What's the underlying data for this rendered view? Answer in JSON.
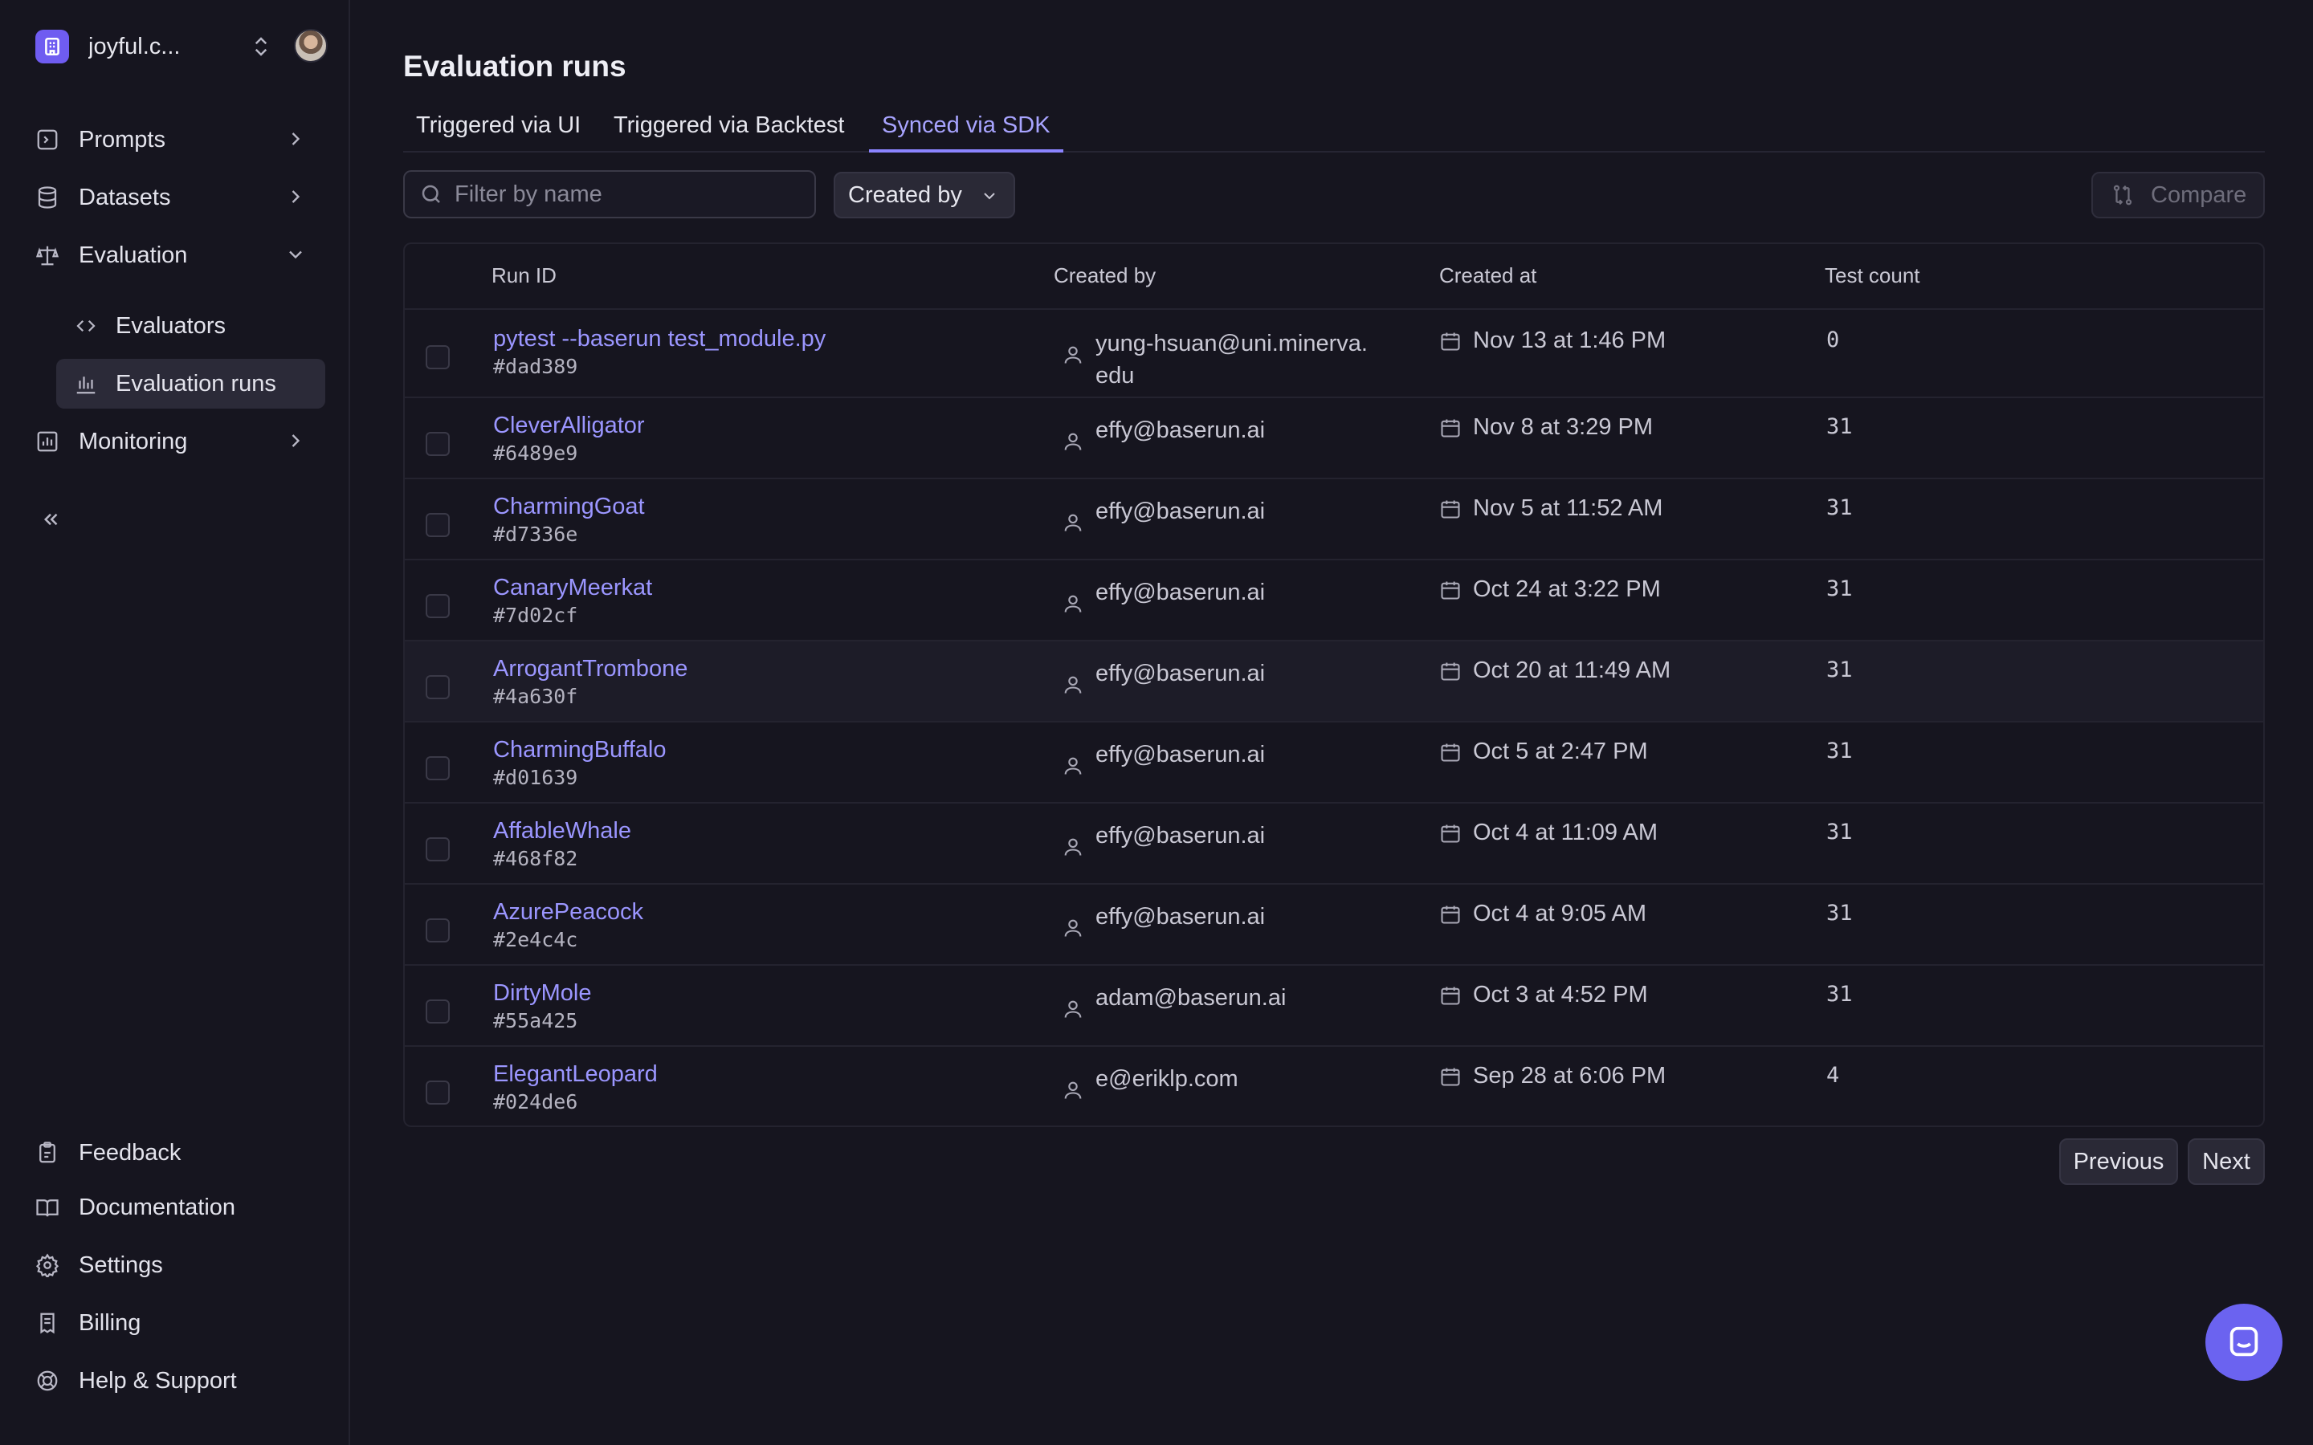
{
  "org": {
    "name": "joyful.c...",
    "logo_icon": "building-icon"
  },
  "sidebar": {
    "items": [
      {
        "label": "Prompts",
        "icon": "prompt-icon",
        "expanded": false
      },
      {
        "label": "Datasets",
        "icon": "database-icon",
        "expanded": false
      },
      {
        "label": "Evaluation",
        "icon": "scale-icon",
        "expanded": true
      },
      {
        "label": "Monitoring",
        "icon": "chart-icon",
        "expanded": false
      }
    ],
    "evaluation_children": [
      {
        "label": "Evaluators",
        "icon": "code-icon"
      },
      {
        "label": "Evaluation runs",
        "icon": "bar-chart-icon",
        "active": true
      }
    ],
    "footer": [
      {
        "label": "Feedback",
        "icon": "clipboard-icon"
      },
      {
        "label": "Documentation",
        "icon": "book-icon"
      },
      {
        "label": "Settings",
        "icon": "gear-icon"
      },
      {
        "label": "Billing",
        "icon": "receipt-icon"
      },
      {
        "label": "Help & Support",
        "icon": "lifebuoy-icon"
      }
    ]
  },
  "page": {
    "title": "Evaluation runs"
  },
  "tabs": [
    {
      "label": "Triggered via UI"
    },
    {
      "label": "Triggered via Backtest"
    },
    {
      "label": "Synced via SDK",
      "active": true
    }
  ],
  "filters": {
    "search_placeholder": "Filter by name",
    "search_value": "",
    "created_by_label": "Created by",
    "compare_label": "Compare"
  },
  "table": {
    "columns": [
      "Run ID",
      "Created by",
      "Created at",
      "Test count"
    ],
    "rows": [
      {
        "name": "pytest --baserun test_module.py",
        "hash": "#dad389",
        "creator": "yung-hsuan@uni.minerva.edu",
        "created_at": "Nov 13 at 1:46 PM",
        "count": "0"
      },
      {
        "name": "CleverAlligator",
        "hash": "#6489e9",
        "creator": "effy@baserun.ai",
        "created_at": "Nov 8 at 3:29 PM",
        "count": "31"
      },
      {
        "name": "CharmingGoat",
        "hash": "#d7336e",
        "creator": "effy@baserun.ai",
        "created_at": "Nov 5 at 11:52 AM",
        "count": "31"
      },
      {
        "name": "CanaryMeerkat",
        "hash": "#7d02cf",
        "creator": "effy@baserun.ai",
        "created_at": "Oct 24 at 3:22 PM",
        "count": "31"
      },
      {
        "name": "ArrogantTrombone",
        "hash": "#4a630f",
        "creator": "effy@baserun.ai",
        "created_at": "Oct 20 at 11:49 AM",
        "count": "31"
      },
      {
        "name": "CharmingBuffalo",
        "hash": "#d01639",
        "creator": "effy@baserun.ai",
        "created_at": "Oct 5 at 2:47 PM",
        "count": "31"
      },
      {
        "name": "AffableWhale",
        "hash": "#468f82",
        "creator": "effy@baserun.ai",
        "created_at": "Oct 4 at 11:09 AM",
        "count": "31"
      },
      {
        "name": "AzurePeacock",
        "hash": "#2e4c4c",
        "creator": "effy@baserun.ai",
        "created_at": "Oct 4 at 9:05 AM",
        "count": "31"
      },
      {
        "name": "DirtyMole",
        "hash": "#55a425",
        "creator": "adam@baserun.ai",
        "created_at": "Oct 3 at 4:52 PM",
        "count": "31"
      },
      {
        "name": "ElegantLeopard",
        "hash": "#024de6",
        "creator": "e@eriklp.com",
        "created_at": "Sep 28 at 6:06 PM",
        "count": "4"
      }
    ]
  },
  "pagination": {
    "previous_label": "Previous",
    "next_label": "Next"
  },
  "colors": {
    "accent": "#8b84ff",
    "link": "#9b96ff",
    "background": "#16151f",
    "fab": "#6b63f0"
  }
}
